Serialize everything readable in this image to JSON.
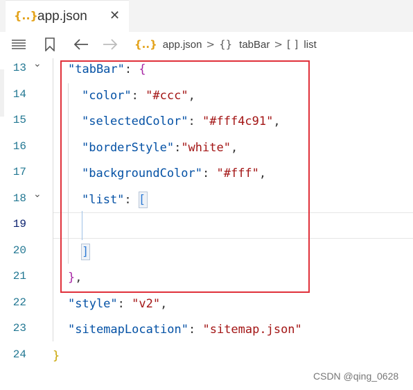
{
  "tab": {
    "icon": "{..}",
    "label": "app.json",
    "close": "✕"
  },
  "toolbar": {
    "list_icon": "list-icon",
    "bookmark_icon": "bookmark-icon",
    "back_icon": "arrow-left-icon",
    "forward_icon": "arrow-right-icon"
  },
  "breadcrumb": {
    "file_icon": "{..}",
    "file": "app.json",
    "sep1": ">",
    "obj_icon": "{}",
    "obj": "tabBar",
    "sep2": ">",
    "arr_icon": "[ ]",
    "arr": "list"
  },
  "lines": [
    {
      "num": "13",
      "fold": "⌄"
    },
    {
      "num": "14"
    },
    {
      "num": "15"
    },
    {
      "num": "16"
    },
    {
      "num": "17"
    },
    {
      "num": "18",
      "fold": "⌄"
    },
    {
      "num": "19"
    },
    {
      "num": "20"
    },
    {
      "num": "21"
    },
    {
      "num": "22"
    },
    {
      "num": "23"
    },
    {
      "num": "24"
    }
  ],
  "code": {
    "l13_key": "\"tabBar\"",
    "l13_colon": ": ",
    "l13_brace": "{",
    "l14_key": "\"color\"",
    "l14_colon": ": ",
    "l14_val": "\"#ccc\"",
    "l14_comma": ",",
    "l15_key": "\"selectedColor\"",
    "l15_colon": ": ",
    "l15_val": "\"#fff4c91\"",
    "l15_comma": ",",
    "l16_key": "\"borderStyle\"",
    "l16_colon": ":",
    "l16_val": "\"white\"",
    "l16_comma": ",",
    "l17_key": "\"backgroundColor\"",
    "l17_colon": ": ",
    "l17_val": "\"#fff\"",
    "l17_comma": ",",
    "l18_key": "\"list\"",
    "l18_colon": ": ",
    "l18_bracket": "[",
    "l20_bracket": "]",
    "l21_brace": "}",
    "l21_comma": ",",
    "l22_key": "\"style\"",
    "l22_colon": ": ",
    "l22_val": "\"v2\"",
    "l22_comma": ",",
    "l23_key": "\"sitemapLocation\"",
    "l23_colon": ": ",
    "l23_val": "\"sitemap.json\"",
    "l24_brace": "}"
  },
  "watermark": "CSDN @qing_0628",
  "colors": {
    "key": "#0451a5",
    "string": "#a31515",
    "highlight_box": "#e0303a",
    "line_number": "#237893"
  }
}
